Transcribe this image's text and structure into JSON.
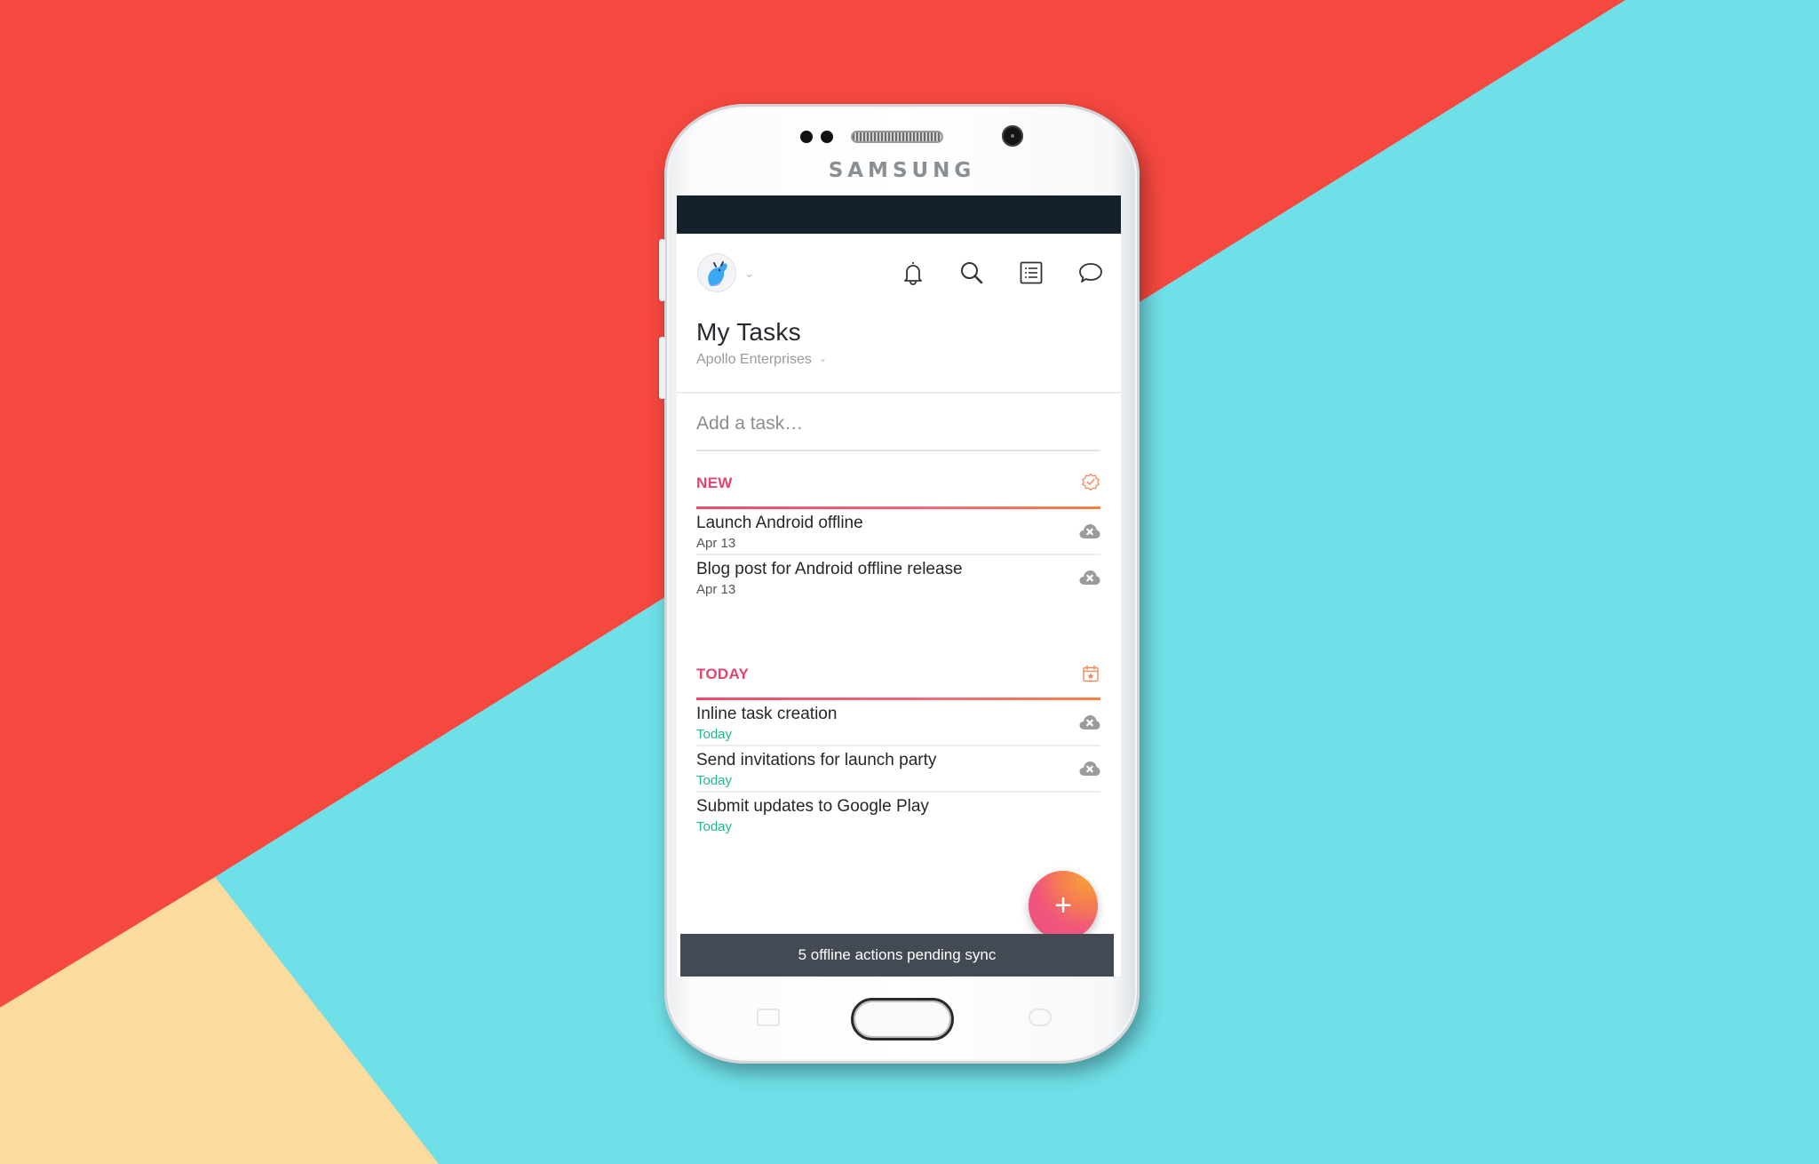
{
  "device": {
    "brand": "SAMSUNG"
  },
  "colors": {
    "background_red": "#f5483f",
    "background_cyan": "#6fe0e8",
    "background_yellow": "#fbdb9e",
    "status_bar": "#14202c",
    "section_label": "#e8436a",
    "today_green": "#1fb893",
    "icon_orange": "#f08a5d",
    "snackbar_bg": "#434a53"
  },
  "header": {
    "avatar_icon": "user-avatar-monster",
    "avatar_dropdown_icon": "chevron-down-icon",
    "actions": [
      {
        "name": "notifications",
        "icon": "bell-icon"
      },
      {
        "name": "search",
        "icon": "search-icon"
      },
      {
        "name": "projects",
        "icon": "list-icon"
      },
      {
        "name": "conversations",
        "icon": "chat-bubble-icon"
      }
    ],
    "title": "My Tasks",
    "workspace": "Apollo Enterprises"
  },
  "add_task": {
    "placeholder": "Add a task…",
    "value": ""
  },
  "sections": [
    {
      "label": "NEW",
      "icon": "badge-check-icon",
      "tasks": [
        {
          "title": "Launch Android offline",
          "date": "Apr 13",
          "sync_icon": "cloud-offline-icon"
        },
        {
          "title": "Blog post for Android offline release",
          "date": "Apr 13",
          "sync_icon": "cloud-offline-icon"
        }
      ]
    },
    {
      "label": "TODAY",
      "icon": "calendar-star-icon",
      "tasks": [
        {
          "title": "Inline task creation",
          "date": "Today",
          "sync_icon": "cloud-offline-icon"
        },
        {
          "title": "Send invitations for launch party",
          "date": "Today",
          "sync_icon": "cloud-offline-icon"
        },
        {
          "title": "Submit updates to Google Play",
          "date": "Today",
          "sync_icon": null
        }
      ]
    }
  ],
  "fab": {
    "label": "+",
    "icon": "plus-icon"
  },
  "snackbar": {
    "message": "5 offline actions pending sync"
  }
}
